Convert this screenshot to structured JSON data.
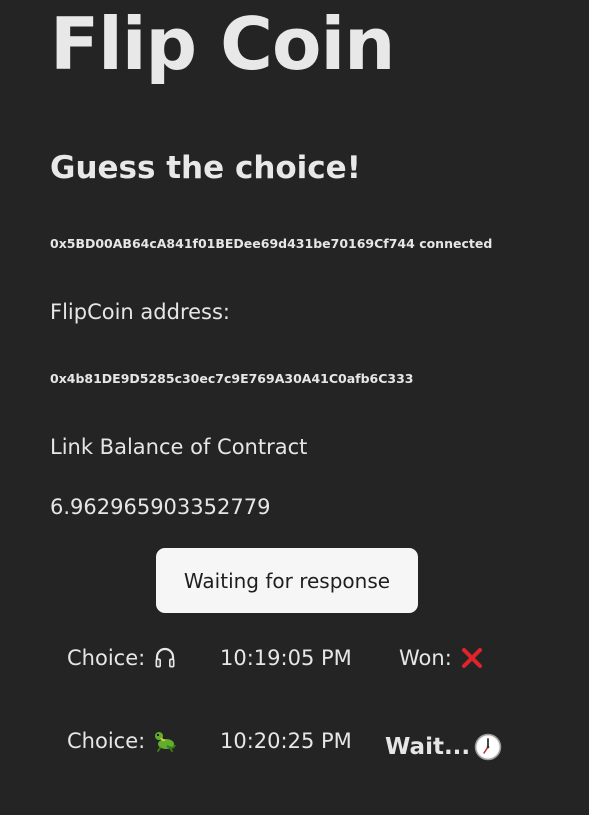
{
  "app": {
    "title": "Flip Coin",
    "subtitle": "Guess the choice!"
  },
  "wallet": {
    "address": "0x5BD00AB64cA841f01BEDee69d431be70169Cf744",
    "status": "connected"
  },
  "contract": {
    "address_label": "FlipCoin address:",
    "address": "0x4b81DE9D5285c30ec7c9E769A30A41C0afb6C333",
    "balance_label": "Link Balance of Contract",
    "balance": "6.962965903352779"
  },
  "action_button": {
    "label": "Waiting for response"
  },
  "history": [
    {
      "choice_label": "Choice:",
      "choice_icon": "headphones-icon",
      "time": "10:19:05 PM",
      "result_label": "Won:",
      "result_icon": "cross-mark-icon"
    },
    {
      "choice_label": "Choice:",
      "choice_icon": "lizard-icon",
      "time": "10:20:25 PM",
      "result_label": "Wait...",
      "result_icon": "clock-icon"
    }
  ],
  "colors": {
    "background": "#242424",
    "text": "#e6e6e6",
    "button_bg": "#f6f6f6",
    "cross": "#e0242b"
  }
}
